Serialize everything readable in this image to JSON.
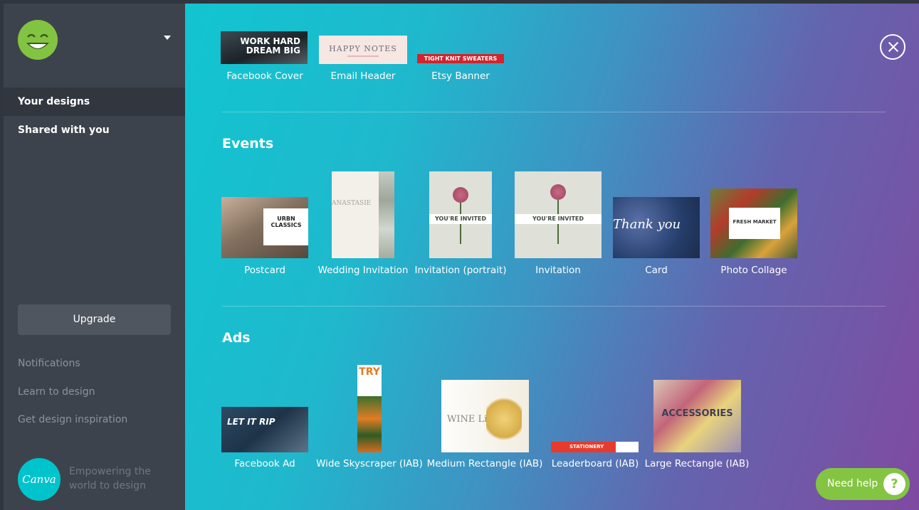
{
  "sidebar": {
    "nav": [
      {
        "label": "Your designs",
        "active": true
      },
      {
        "label": "Shared with you",
        "active": false
      }
    ],
    "upgrade_label": "Upgrade",
    "links": [
      "Notifications",
      "Learn to design",
      "Get design inspiration"
    ],
    "logo_text": "Canva",
    "tagline": "Empowering the world to design"
  },
  "top_row": [
    {
      "label": "Facebook Cover",
      "thumb_text": "WORK HARD DREAM BIG"
    },
    {
      "label": "Email Header",
      "thumb_text": "HAPPY NOTES"
    },
    {
      "label": "Etsy Banner",
      "thumb_text": "TIGHT KNIT SWEATERS"
    }
  ],
  "events": {
    "title": "Events",
    "items": [
      {
        "label": "Postcard",
        "thumb_text": "URBN CLASSICS"
      },
      {
        "label": "Wedding Invitation",
        "thumb_text": "ANASTASIE"
      },
      {
        "label": "Invitation (portrait)",
        "thumb_text": "YOU'RE INVITED"
      },
      {
        "label": "Invitation",
        "thumb_text": "YOU'RE INVITED"
      },
      {
        "label": "Card",
        "thumb_text": "Thank you"
      },
      {
        "label": "Photo Collage",
        "thumb_text": "FRESH MARKET"
      }
    ]
  },
  "ads": {
    "title": "Ads",
    "items": [
      {
        "label": "Facebook Ad",
        "thumb_text": "LET IT RIP"
      },
      {
        "label": "Wide Skyscraper (IAB)",
        "thumb_text": "TRY"
      },
      {
        "label": "Medium Rectangle (IAB)",
        "thumb_text": "WINE List"
      },
      {
        "label": "Leaderboard (IAB)",
        "thumb_text": "STATIONERY"
      },
      {
        "label": "Large Rectangle (IAB)",
        "thumb_text": "ACCESSORIES"
      }
    ]
  },
  "help": {
    "label": "Need help",
    "icon": "?"
  },
  "colors": {
    "sidebar_bg": "#3d434c",
    "gradient_start": "#12c5d0",
    "gradient_end": "#7f4aa1",
    "help_green": "#84c443",
    "canva_teal": "#00c4cc"
  }
}
